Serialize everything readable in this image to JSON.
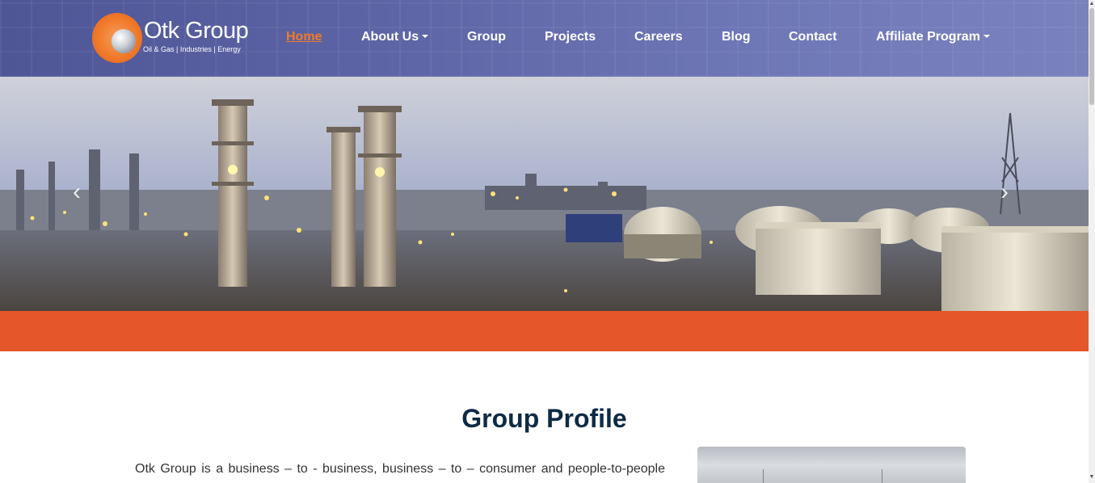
{
  "brand": {
    "name": "Otk Group",
    "tagline": "Oil & Gas | Industries | Energy"
  },
  "nav": {
    "items": [
      {
        "label": "Home",
        "active": true,
        "dropdown": false
      },
      {
        "label": "About Us",
        "active": false,
        "dropdown": true
      },
      {
        "label": "Group",
        "active": false,
        "dropdown": false
      },
      {
        "label": "Projects",
        "active": false,
        "dropdown": false
      },
      {
        "label": "Careers",
        "active": false,
        "dropdown": false
      },
      {
        "label": "Blog",
        "active": false,
        "dropdown": false
      },
      {
        "label": "Contact",
        "active": false,
        "dropdown": false
      },
      {
        "label": "Affiliate Program",
        "active": false,
        "dropdown": true
      }
    ]
  },
  "hero": {
    "prev_icon": "chevron-left-icon",
    "next_icon": "chevron-right-icon",
    "prev_glyph": "‹",
    "next_glyph": "›"
  },
  "profile": {
    "title": "Group Profile",
    "text": "Otk Group is a business – to - business, business – to – consumer and people-to-people"
  },
  "colors": {
    "header": "#5d64a6",
    "accent": "#f07a2a",
    "band": "#e5562a",
    "title": "#0f2a44"
  }
}
